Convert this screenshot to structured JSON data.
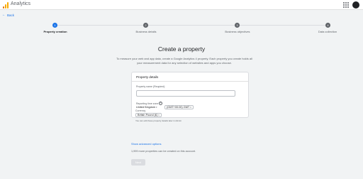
{
  "app": {
    "title": "Analytics"
  },
  "nav": {
    "back_label": "Back"
  },
  "stepper": {
    "steps": [
      {
        "number": "1",
        "label": "Property creation",
        "active": true
      },
      {
        "number": "2",
        "label": "Business details",
        "active": false
      },
      {
        "number": "3",
        "label": "Business objectives",
        "active": false
      },
      {
        "number": "4",
        "label": "Data collection",
        "active": false
      }
    ]
  },
  "main": {
    "title": "Create a property",
    "intro": "To measure your web and app data, create a Google Analytics 4 property. Each property you create holds all your measurement data for any selection of websites and apps you choose."
  },
  "card": {
    "title": "Property details",
    "property_name_label": "Property name (Required)",
    "property_name_value": "",
    "reporting_time_zone_label": "Reporting time zone",
    "country_value": "United Kingdom",
    "timezone_value": "(GMT+00:00) GMT",
    "currency_label": "Currency",
    "currency_value": "British Pound (£)",
    "note": "You can edit these property details later in Admin"
  },
  "advanced_link": "Show advanced options",
  "remaining_text": "1,999 more properties can be created on this account.",
  "next_label": "Next",
  "colors": {
    "accent": "#1a73e8",
    "background": "#f1f3f4",
    "logo_orange": "#e37400",
    "logo_yellow": "#f9ab00"
  },
  "icons": {
    "back": "arrow-left-icon",
    "apps": "apps-grid-icon",
    "help": "help-icon",
    "dropdown": "caret-down-icon"
  }
}
